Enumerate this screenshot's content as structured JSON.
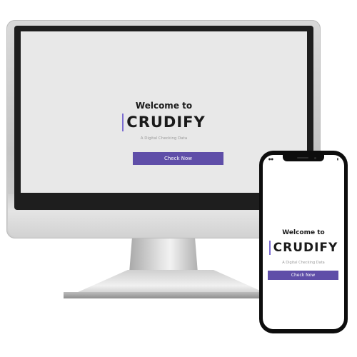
{
  "desktop": {
    "welcome": "Welcome to",
    "brand": "CRUDIFY",
    "tagline": "A Digital Checking Data",
    "cta_label": "Check Now"
  },
  "mobile": {
    "welcome": "Welcome to",
    "brand": "CRUDIFY",
    "tagline": "A Digital Checking Data",
    "cta_label": "Check Now"
  },
  "colors": {
    "accent": "#5f4ea8",
    "brand_bar": "#7a6bd0",
    "text": "#1a1a1a",
    "muted": "#9a9a9a"
  }
}
